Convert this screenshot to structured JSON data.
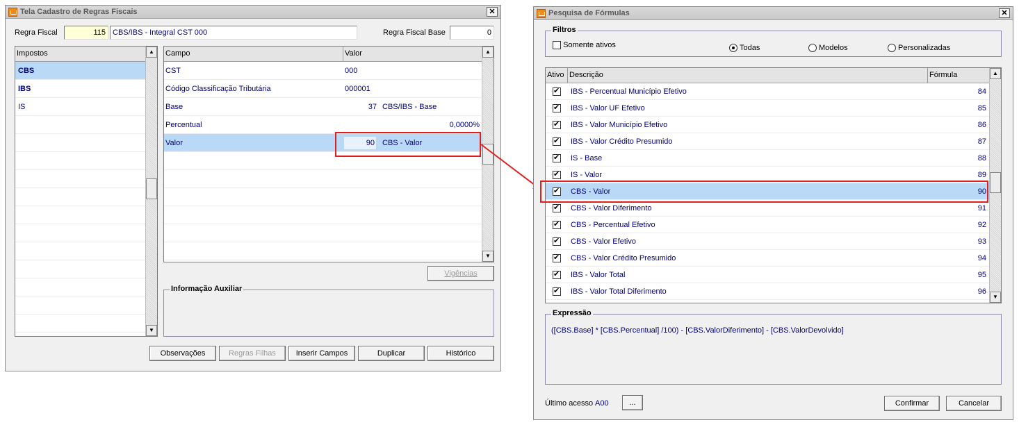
{
  "left_window": {
    "title": "Tela Cadastro de Regras Fiscais",
    "regra_fiscal_label": "Regra Fiscal",
    "regra_fiscal_code": "115",
    "regra_fiscal_desc": "CBS/IBS - Integral CST 000",
    "regra_fiscal_base_label": "Regra Fiscal Base",
    "regra_fiscal_base_value": "0",
    "impostos_header": "Impostos",
    "impostos": [
      "CBS",
      "IBS",
      "IS"
    ],
    "campo_header": "Campo",
    "valor_header": "Valor",
    "fields": [
      {
        "campo": "CST",
        "valor": "000",
        "desc": ""
      },
      {
        "campo": "Código Classificação Tributária",
        "valor": "000001",
        "desc": ""
      },
      {
        "campo": "Base",
        "valor": "37",
        "desc": "CBS/IBS - Base"
      },
      {
        "campo": "Percentual",
        "valor": "0,0000%",
        "desc": ""
      },
      {
        "campo": "Valor",
        "valor": "90",
        "desc": "CBS - Valor"
      }
    ],
    "vigencias_button": "Vigências",
    "info_aux_label": "Informação Auxiliar",
    "buttons": {
      "observacoes": "Observações",
      "regras_filhas": "Regras Filhas",
      "inserir_campos": "Inserir Campos",
      "duplicar": "Duplicar",
      "historico": "Histórico"
    }
  },
  "right_window": {
    "title": "Pesquisa de Fórmulas",
    "filtros_label": "Filtros",
    "somente_ativos": "Somente ativos",
    "radio_todas": "Todas",
    "radio_modelos": "Modelos",
    "radio_personalizadas": "Personalizadas",
    "selected_filter": "Todas",
    "col_ativo": "Ativo",
    "col_descricao": "Descrição",
    "col_formula": "Fórmula",
    "formulas": [
      {
        "descricao": "IBS - Percentual Município Efetivo",
        "formula": "84"
      },
      {
        "descricao": "IBS - Valor UF Efetivo",
        "formula": "85"
      },
      {
        "descricao": "IBS - Valor Município Efetivo",
        "formula": "86"
      },
      {
        "descricao": "IBS - Valor Crédito Presumido",
        "formula": "87"
      },
      {
        "descricao": "IS - Base",
        "formula": "88"
      },
      {
        "descricao": "IS - Valor",
        "formula": "89"
      },
      {
        "descricao": "CBS - Valor",
        "formula": "90"
      },
      {
        "descricao": "CBS - Valor Diferimento",
        "formula": "91"
      },
      {
        "descricao": "CBS - Percentual Efetivo",
        "formula": "92"
      },
      {
        "descricao": "CBS - Valor Efetivo",
        "formula": "93"
      },
      {
        "descricao": "CBS - Valor Crédito Presumido",
        "formula": "94"
      },
      {
        "descricao": "IBS - Valor Total",
        "formula": "95"
      },
      {
        "descricao": "IBS - Valor Total Diferimento",
        "formula": "96"
      }
    ],
    "selected_formula": "90",
    "expressao_label": "Expressão",
    "expressao_value": "([CBS.Base] * [CBS.Percentual] /100) - [CBS.ValorDiferimento] - [CBS.ValorDevolvido]",
    "ultimo_acesso_label": "Último acesso",
    "ultimo_acesso_value": "A00",
    "ellipsis_button": "...",
    "confirmar_button": "Confirmar",
    "cancelar_button": "Cancelar"
  },
  "colors": {
    "selection": "#b9d9f7",
    "highlight_red": "#e02020",
    "value_text": "#00007a"
  }
}
